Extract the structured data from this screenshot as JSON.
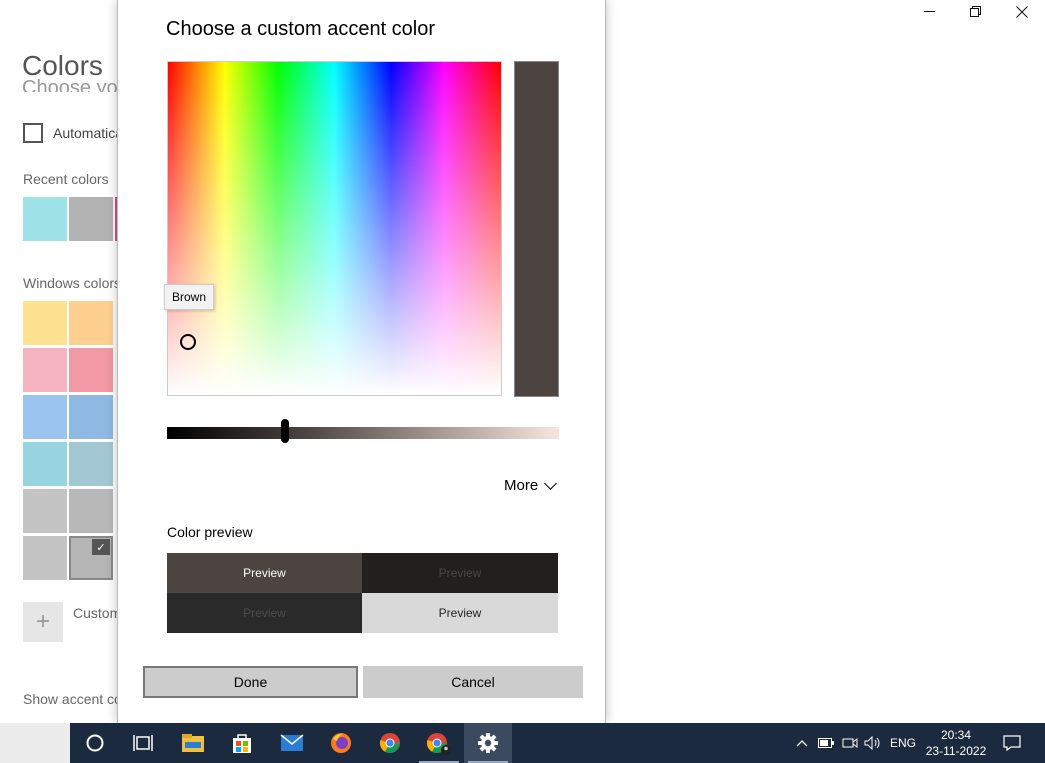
{
  "settings": {
    "page_title": "Colors",
    "clipped_heading": "Choose yo",
    "auto_label": "Automatica",
    "recent_label": "Recent colors",
    "windows_label": "Windows colors",
    "custom_label": "Custom",
    "show_accent_label": "Show accent co",
    "recent_colors": [
      "#9fe3e8",
      "#b3b3b3",
      "#e8467a"
    ],
    "windows_colors": [
      [
        "#ffe291",
        "#fdd08f"
      ],
      [
        "#f4b5c1",
        "#f19aa5"
      ],
      [
        "#9bc5ef",
        "#8fb8e2"
      ],
      [
        "#97d6e1",
        "#a4c7d4"
      ],
      [
        "#c4c4c4",
        "#b8b8b8"
      ],
      [
        "#c4c4c4",
        "#b5b5b5"
      ]
    ]
  },
  "dialog": {
    "title": "Choose a custom accent color",
    "tooltip": "Brown",
    "more_label": "More",
    "preview_label": "Color preview",
    "preview_cells": [
      {
        "text": "Preview",
        "bg": "#4b4440",
        "fg": "#ffffff"
      },
      {
        "text": "Preview",
        "bg": "#231f1d",
        "fg": "#4a4643"
      },
      {
        "text": "Preview",
        "bg": "#2a2a2a",
        "fg": "#4c4c4c"
      },
      {
        "text": "Preview",
        "bg": "#d9d9d9",
        "fg": "#222222"
      }
    ],
    "done_label": "Done",
    "cancel_label": "Cancel",
    "selected_color": "#4b4440",
    "brightness_level": 0.3
  },
  "taskbar": {
    "apps": [
      "cortana-icon",
      "task-view-icon",
      "file-explorer-icon",
      "store-icon",
      "mail-icon",
      "firefox-icon",
      "chrome-icon",
      "chrome-user-icon",
      "settings-icon"
    ],
    "lang": "ENG",
    "time": "20:34",
    "date": "23-11-2022"
  }
}
